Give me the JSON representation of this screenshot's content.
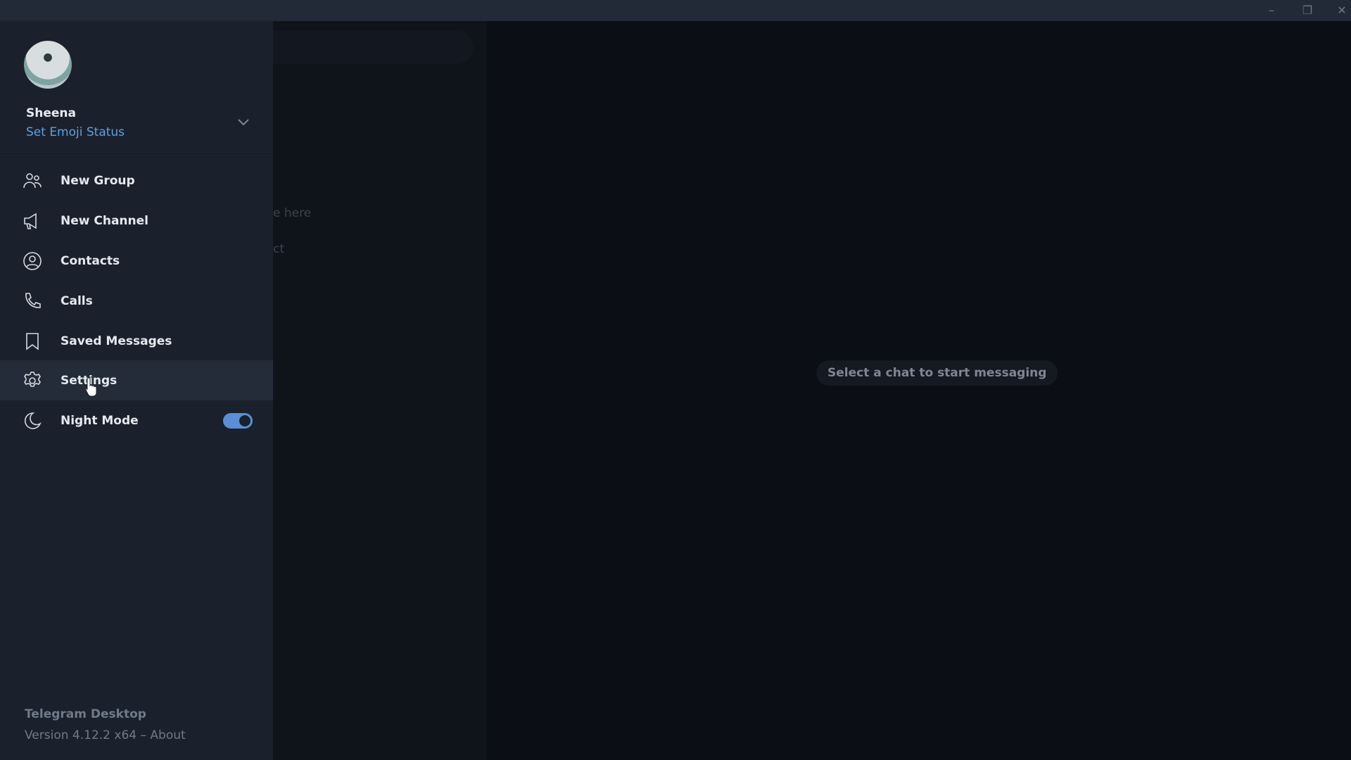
{
  "window": {
    "controls": [
      "minimize",
      "restore",
      "close"
    ]
  },
  "chat_list": {
    "ghost_lines": [
      "e here",
      "ct"
    ]
  },
  "main": {
    "empty_message": "Select a chat to start messaging"
  },
  "profile": {
    "name": "Sheena",
    "status_link": "Set Emoji Status"
  },
  "menu": {
    "items": [
      {
        "label": "New Group",
        "icon": "group-icon"
      },
      {
        "label": "New Channel",
        "icon": "megaphone-icon"
      },
      {
        "label": "Contacts",
        "icon": "contact-icon"
      },
      {
        "label": "Calls",
        "icon": "phone-icon"
      },
      {
        "label": "Saved Messages",
        "icon": "bookmark-icon"
      },
      {
        "label": "Settings",
        "icon": "gear-icon"
      },
      {
        "label": "Night Mode",
        "icon": "moon-icon",
        "toggle": true
      }
    ]
  },
  "night_mode_on": true,
  "footer": {
    "app_name": "Telegram Desktop",
    "version": "Version 4.12.2 x64 – About"
  },
  "colors": {
    "accent": "#5a8fd6",
    "link": "#5fa0e0",
    "sidebar": "#1a212c",
    "background": "#0b0e14"
  }
}
